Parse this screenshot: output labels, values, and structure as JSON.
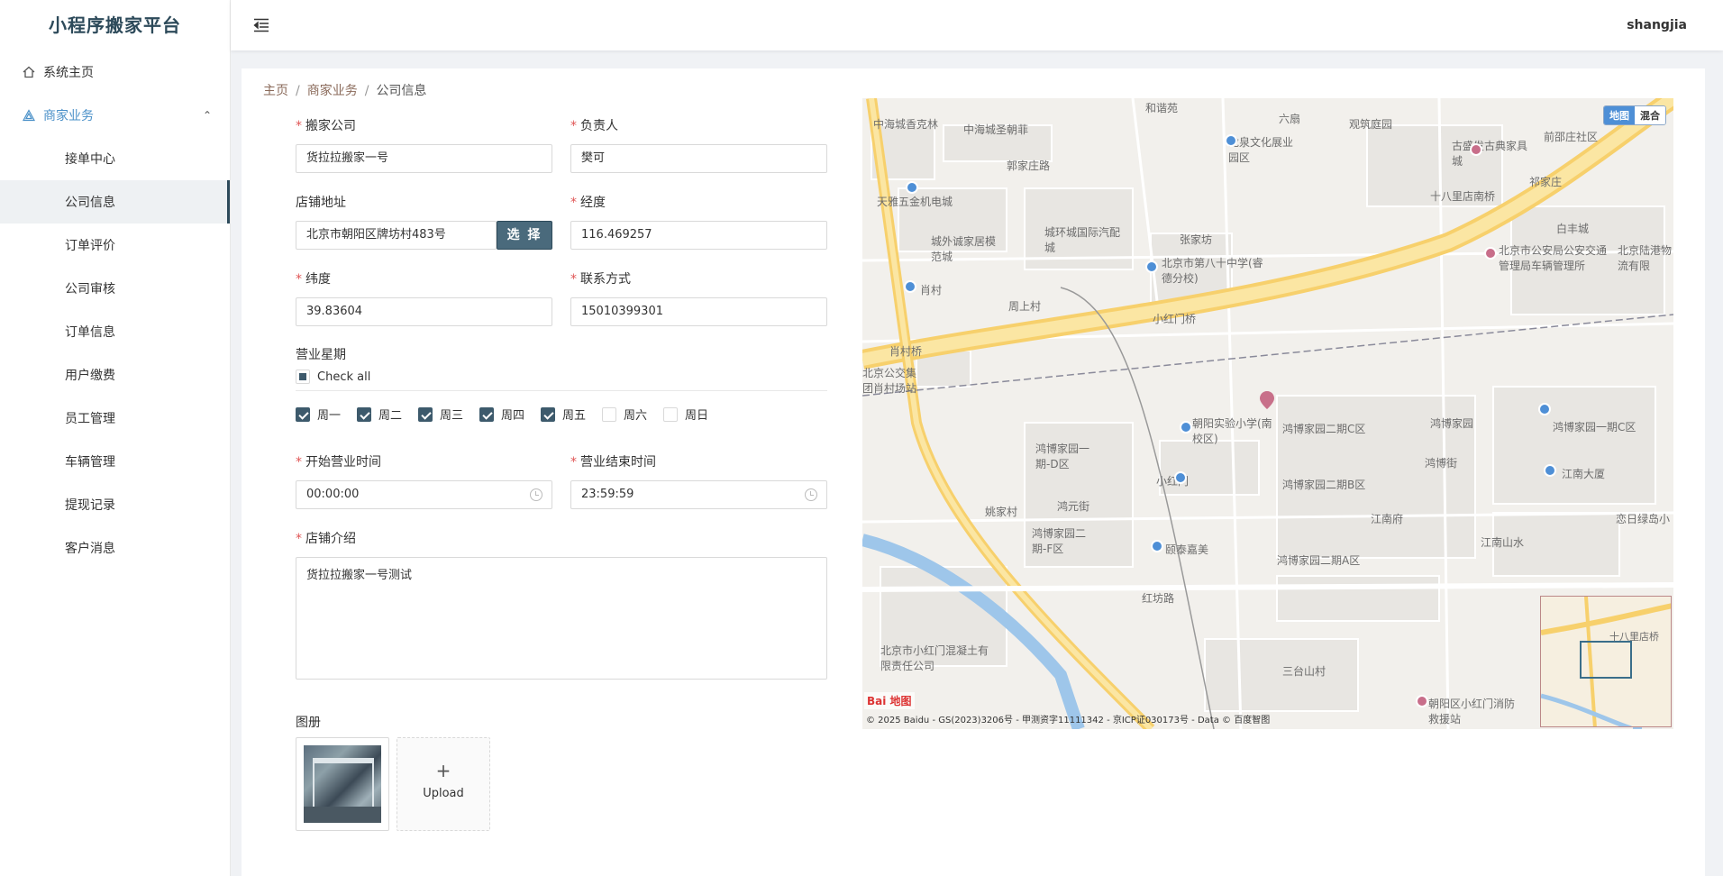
{
  "app": {
    "title": "小程序搬家平台"
  },
  "header": {
    "user": "shangjia"
  },
  "sidebar": {
    "items": [
      {
        "label": "系统主页"
      },
      {
        "label": "商家业务"
      }
    ],
    "subitems": [
      {
        "label": "接单中心"
      },
      {
        "label": "公司信息"
      },
      {
        "label": "订单评价"
      },
      {
        "label": "公司审核"
      },
      {
        "label": "订单信息"
      },
      {
        "label": "用户缴费"
      },
      {
        "label": "员工管理"
      },
      {
        "label": "车辆管理"
      },
      {
        "label": "提现记录"
      },
      {
        "label": "客户消息"
      }
    ]
  },
  "breadcrumb": {
    "home": "主页",
    "section": "商家业务",
    "current": "公司信息"
  },
  "form": {
    "company": {
      "label": "搬家公司",
      "value": "货拉拉搬家一号"
    },
    "manager": {
      "label": "负责人",
      "value": "樊可"
    },
    "address": {
      "label": "店铺地址",
      "value": "北京市朝阳区牌坊村483号",
      "button": "选 择"
    },
    "longitude": {
      "label": "经度",
      "value": "116.469257"
    },
    "latitude": {
      "label": "纬度",
      "value": "39.83604"
    },
    "contact": {
      "label": "联系方式",
      "value": "15010399301"
    },
    "weekdays": {
      "label": "营业星期",
      "check_all": "Check all",
      "days": [
        {
          "label": "周一",
          "checked": true
        },
        {
          "label": "周二",
          "checked": true
        },
        {
          "label": "周三",
          "checked": true
        },
        {
          "label": "周四",
          "checked": true
        },
        {
          "label": "周五",
          "checked": true
        },
        {
          "label": "周六",
          "checked": false
        },
        {
          "label": "周日",
          "checked": false
        }
      ]
    },
    "start_time": {
      "label": "开始营业时间",
      "value": "00:00:00"
    },
    "end_time": {
      "label": "营业结束时间",
      "value": "23:59:59"
    },
    "intro": {
      "label": "店铺介绍",
      "value": "货拉拉搬家一号测试"
    },
    "gallery": {
      "label": "图册",
      "upload": "Upload"
    }
  },
  "map": {
    "toggle": {
      "map": "地图",
      "hybrid": "混合"
    },
    "copyright": "© 2025 Baidu - GS(2023)3206号 - 甲测资字11111342 - 京ICP证030173号 - Data © 百度智图",
    "logo": "Bai 地图",
    "labels": [
      "中海城香克林",
      "中海城圣朝菲",
      "和谐苑",
      "六扇",
      "观筑庭园",
      "龙泉文化展业园区",
      "古盛发古典家具城",
      "前邵庄社区",
      "郭家庄路",
      "祁家庄",
      "十八里店南桥",
      "天雅五金机电城",
      "城外诚家居模范城",
      "城环城国际汽配城",
      "张家坊",
      "北京市第八十中学(睿德分校)",
      "白丰城",
      "北京市公安局公安交通管理局车辆管理所",
      "北京陆港物流有限",
      "肖村",
      "周上村",
      "小红门桥",
      "肖村桥",
      "北京公交集团肖村场站",
      "朝阳实验小学(南校区)",
      "鸿博家园二期C区",
      "鸿博家园",
      "鸿博家园一期C区",
      "鸿博家园一期-D区",
      "鸿博街",
      "江南大厦",
      "小红门",
      "鸿博家园二期B区",
      "姚家村",
      "鸿元街",
      "鸿博家园二期-F区",
      "江南府",
      "恋日绿岛小",
      "颐泰嘉美",
      "江南山水",
      "鸿博家园二期A区",
      "红坊路",
      "北京市小红门混凝土有限责任公司",
      "三台山村",
      "朝阳区小红门消防救援站",
      "十八里店桥"
    ]
  }
}
